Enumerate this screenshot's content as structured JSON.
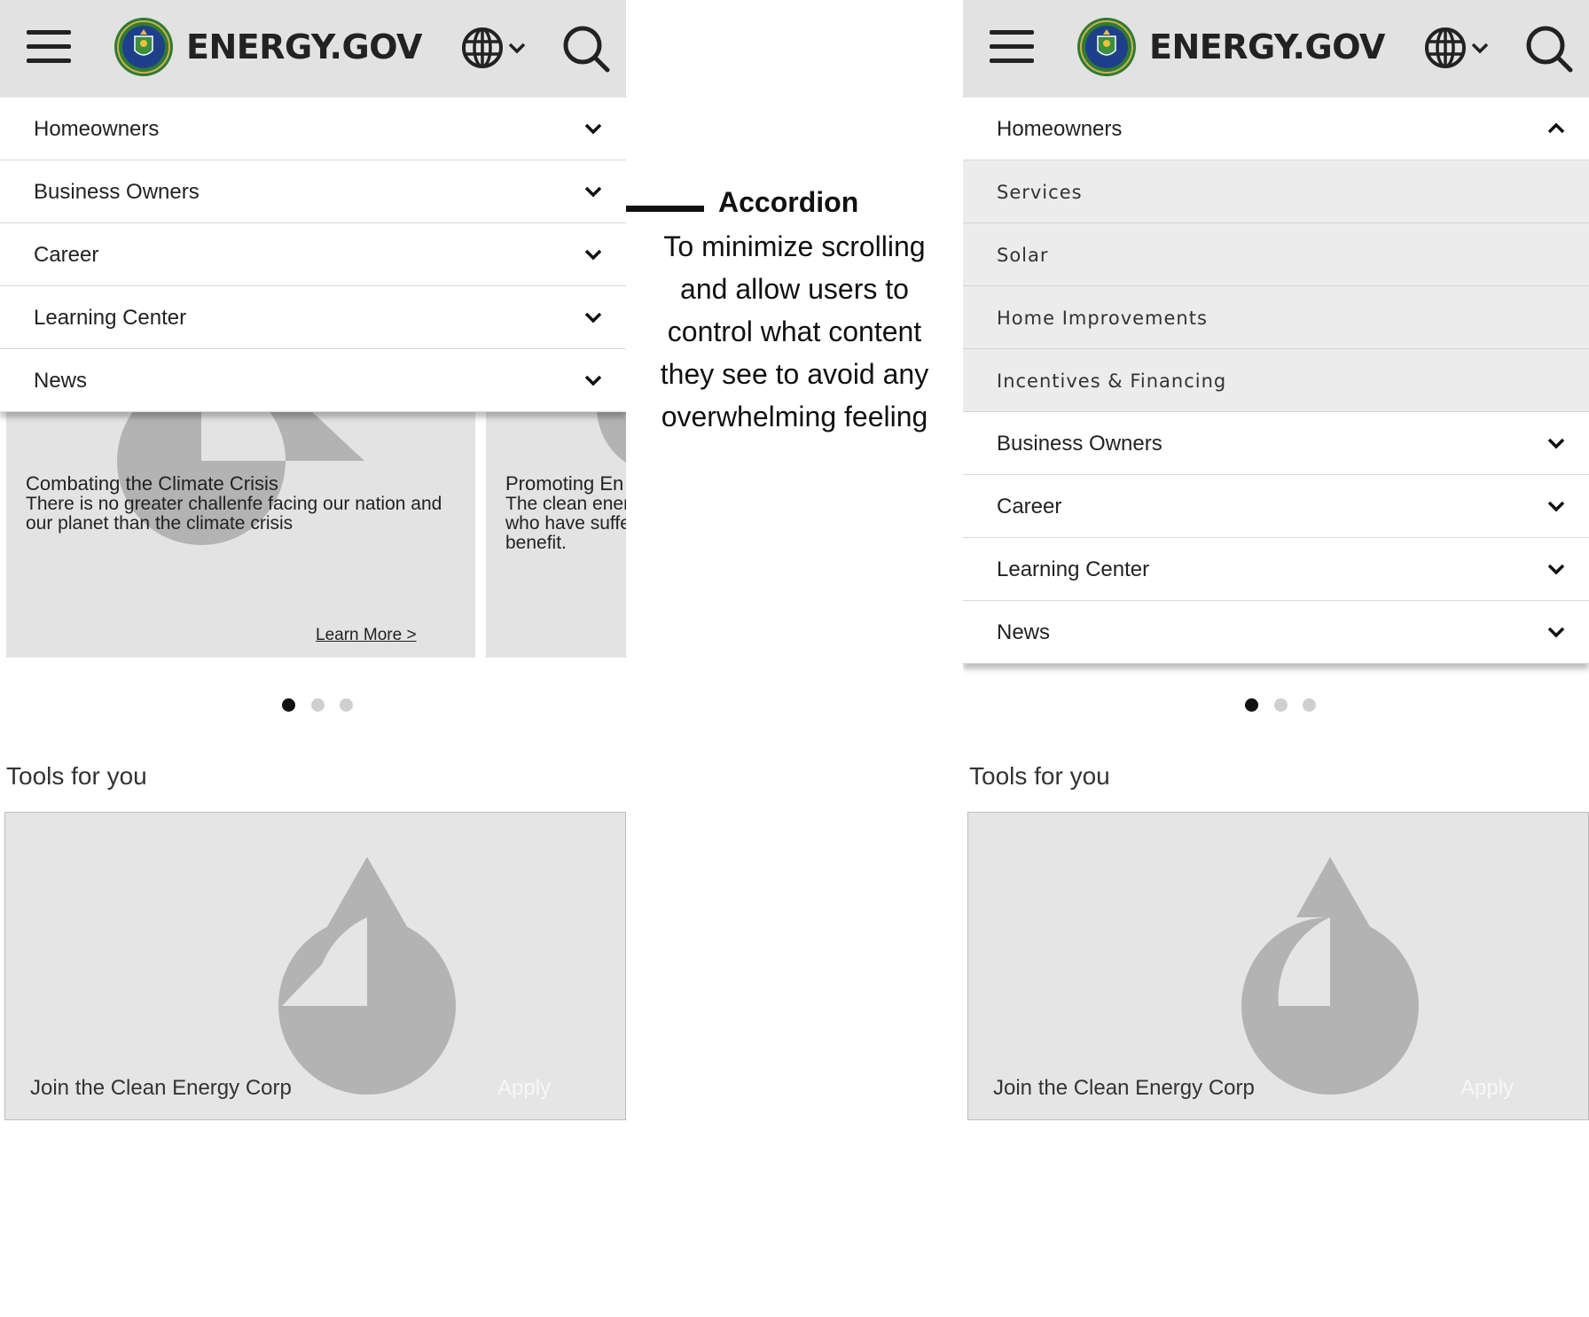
{
  "colors": {
    "header_bg": "#e2e2e2",
    "submenu_bg": "#ececec",
    "card_bg": "#e3e3e3",
    "placeholder_shape": "#b3b3b3",
    "dot_active": "#111111",
    "dot_inactive": "#cfcfcf",
    "seal_green": "#2f7a35",
    "seal_blue": "#1f3f8a"
  },
  "icons": {
    "menu": "hamburger-icon",
    "logo": "doe-seal-icon",
    "language": "globe-icon",
    "search": "search-icon",
    "expand": "chevron-down-icon",
    "collapse": "chevron-up-icon"
  },
  "annotation": {
    "title": "Accordion",
    "body": "To minimize scrolling and allow users to control what content they see to avoid any overwhelming feeling"
  },
  "left_screen": {
    "header": {
      "logo_text": "ENERGY.GOV"
    },
    "menu": [
      {
        "label": "Homeowners",
        "state": "collapsed"
      },
      {
        "label": "Business Owners",
        "state": "collapsed"
      },
      {
        "label": "Career",
        "state": "collapsed"
      },
      {
        "label": "Learning Center",
        "state": "collapsed"
      },
      {
        "label": "News",
        "state": "collapsed"
      }
    ],
    "cards": [
      {
        "title": "Combating the Climate Crisis",
        "description": "There is no greater challenfe facing our nation and our planet than the climate crisis",
        "link": "Learn More >"
      },
      {
        "title": "Promoting En",
        "description": "The clean ener who have suffe benefit."
      }
    ],
    "carousel": {
      "total": 3,
      "active": 1
    },
    "tools": {
      "heading": "Tools for you",
      "card_label": "Join the Clean Energy Corp",
      "card_action": "Apply"
    }
  },
  "right_screen": {
    "header": {
      "logo_text": "ENERGY.GOV"
    },
    "menu": [
      {
        "label": "Homeowners",
        "state": "expanded"
      },
      {
        "label": "Services",
        "state": "submenu"
      },
      {
        "label": "Solar",
        "state": "submenu"
      },
      {
        "label": "Home Improvements",
        "state": "submenu"
      },
      {
        "label": "Incentives & Financing",
        "state": "submenu"
      },
      {
        "label": "Business Owners",
        "state": "collapsed"
      },
      {
        "label": "Career",
        "state": "collapsed"
      },
      {
        "label": "Learning Center",
        "state": "collapsed"
      },
      {
        "label": "News",
        "state": "collapsed"
      }
    ],
    "carousel": {
      "total": 3,
      "active": 1
    },
    "tools": {
      "heading": "Tools for you",
      "card_label": "Join the Clean Energy Corp",
      "card_action": "Apply"
    }
  }
}
